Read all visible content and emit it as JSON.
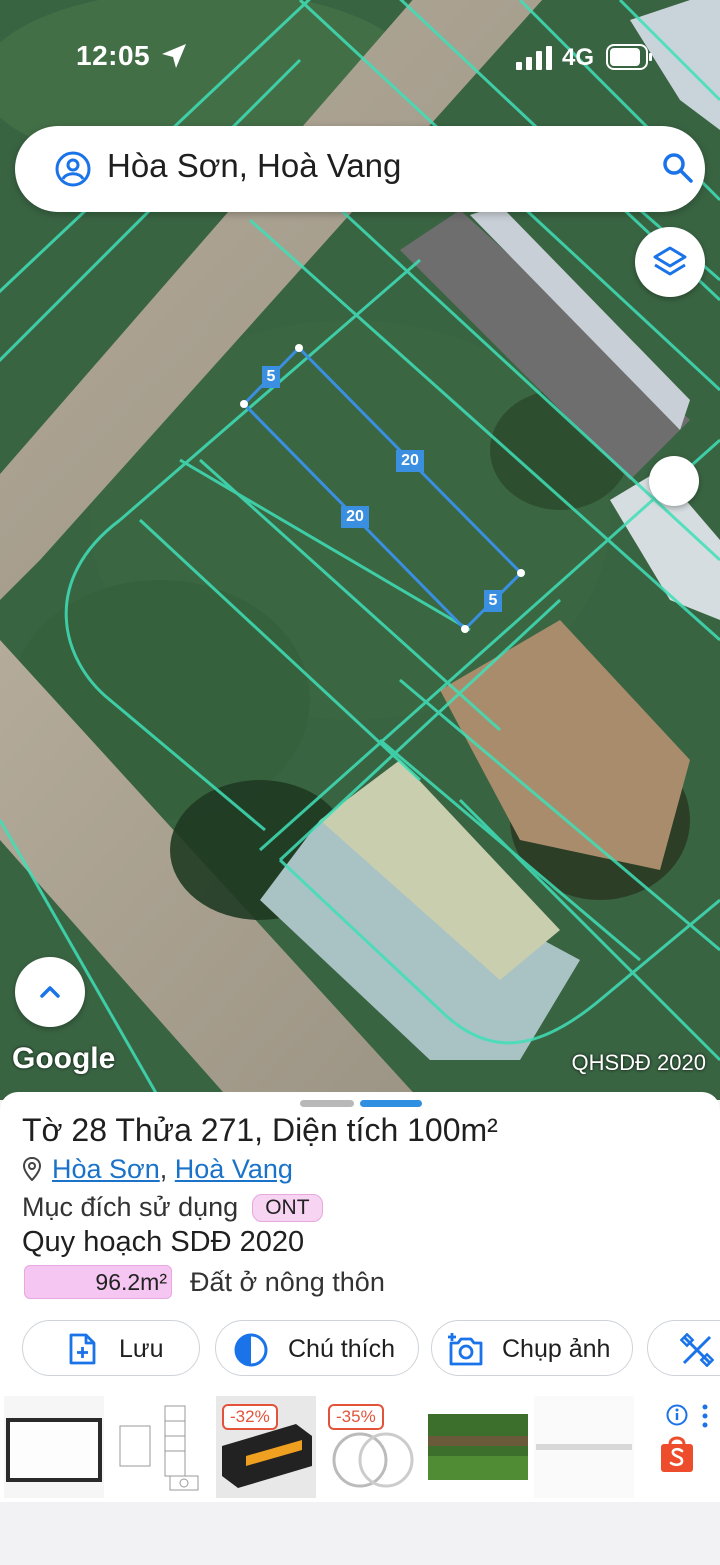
{
  "status_bar": {
    "time": "12:05",
    "network": "4G"
  },
  "search": {
    "query": "Hòa Sơn, Hoà Vang"
  },
  "map": {
    "edge_labels": [
      "5",
      "20",
      "20",
      "5"
    ],
    "attribution": "Google",
    "layer_name": "QHSDĐ 2020",
    "parcel_outline_color": "#3a8fe0",
    "cadastral_line_color": "#3fe0b8"
  },
  "sheet": {
    "title": "Tờ 28 Thửa 271, Diện tích 100m²",
    "ward": "Hòa Sơn",
    "separator": ",",
    "district": "Hoà Vang",
    "purpose_label": "Mục đích sử dụng",
    "purpose_code": "ONT",
    "planning_title": "Quy hoạch SDĐ 2020",
    "planning_area": "96.2m²",
    "planning_desc": "Đất ở nông thôn",
    "planning_color": "#f5c6f2"
  },
  "actions": {
    "save": "Lưu",
    "legend": "Chú thích",
    "photo": "Chụp ảnh"
  },
  "ads": {
    "discounts": [
      "-32%",
      "-35%"
    ],
    "brand_icon": "shopee-icon"
  }
}
